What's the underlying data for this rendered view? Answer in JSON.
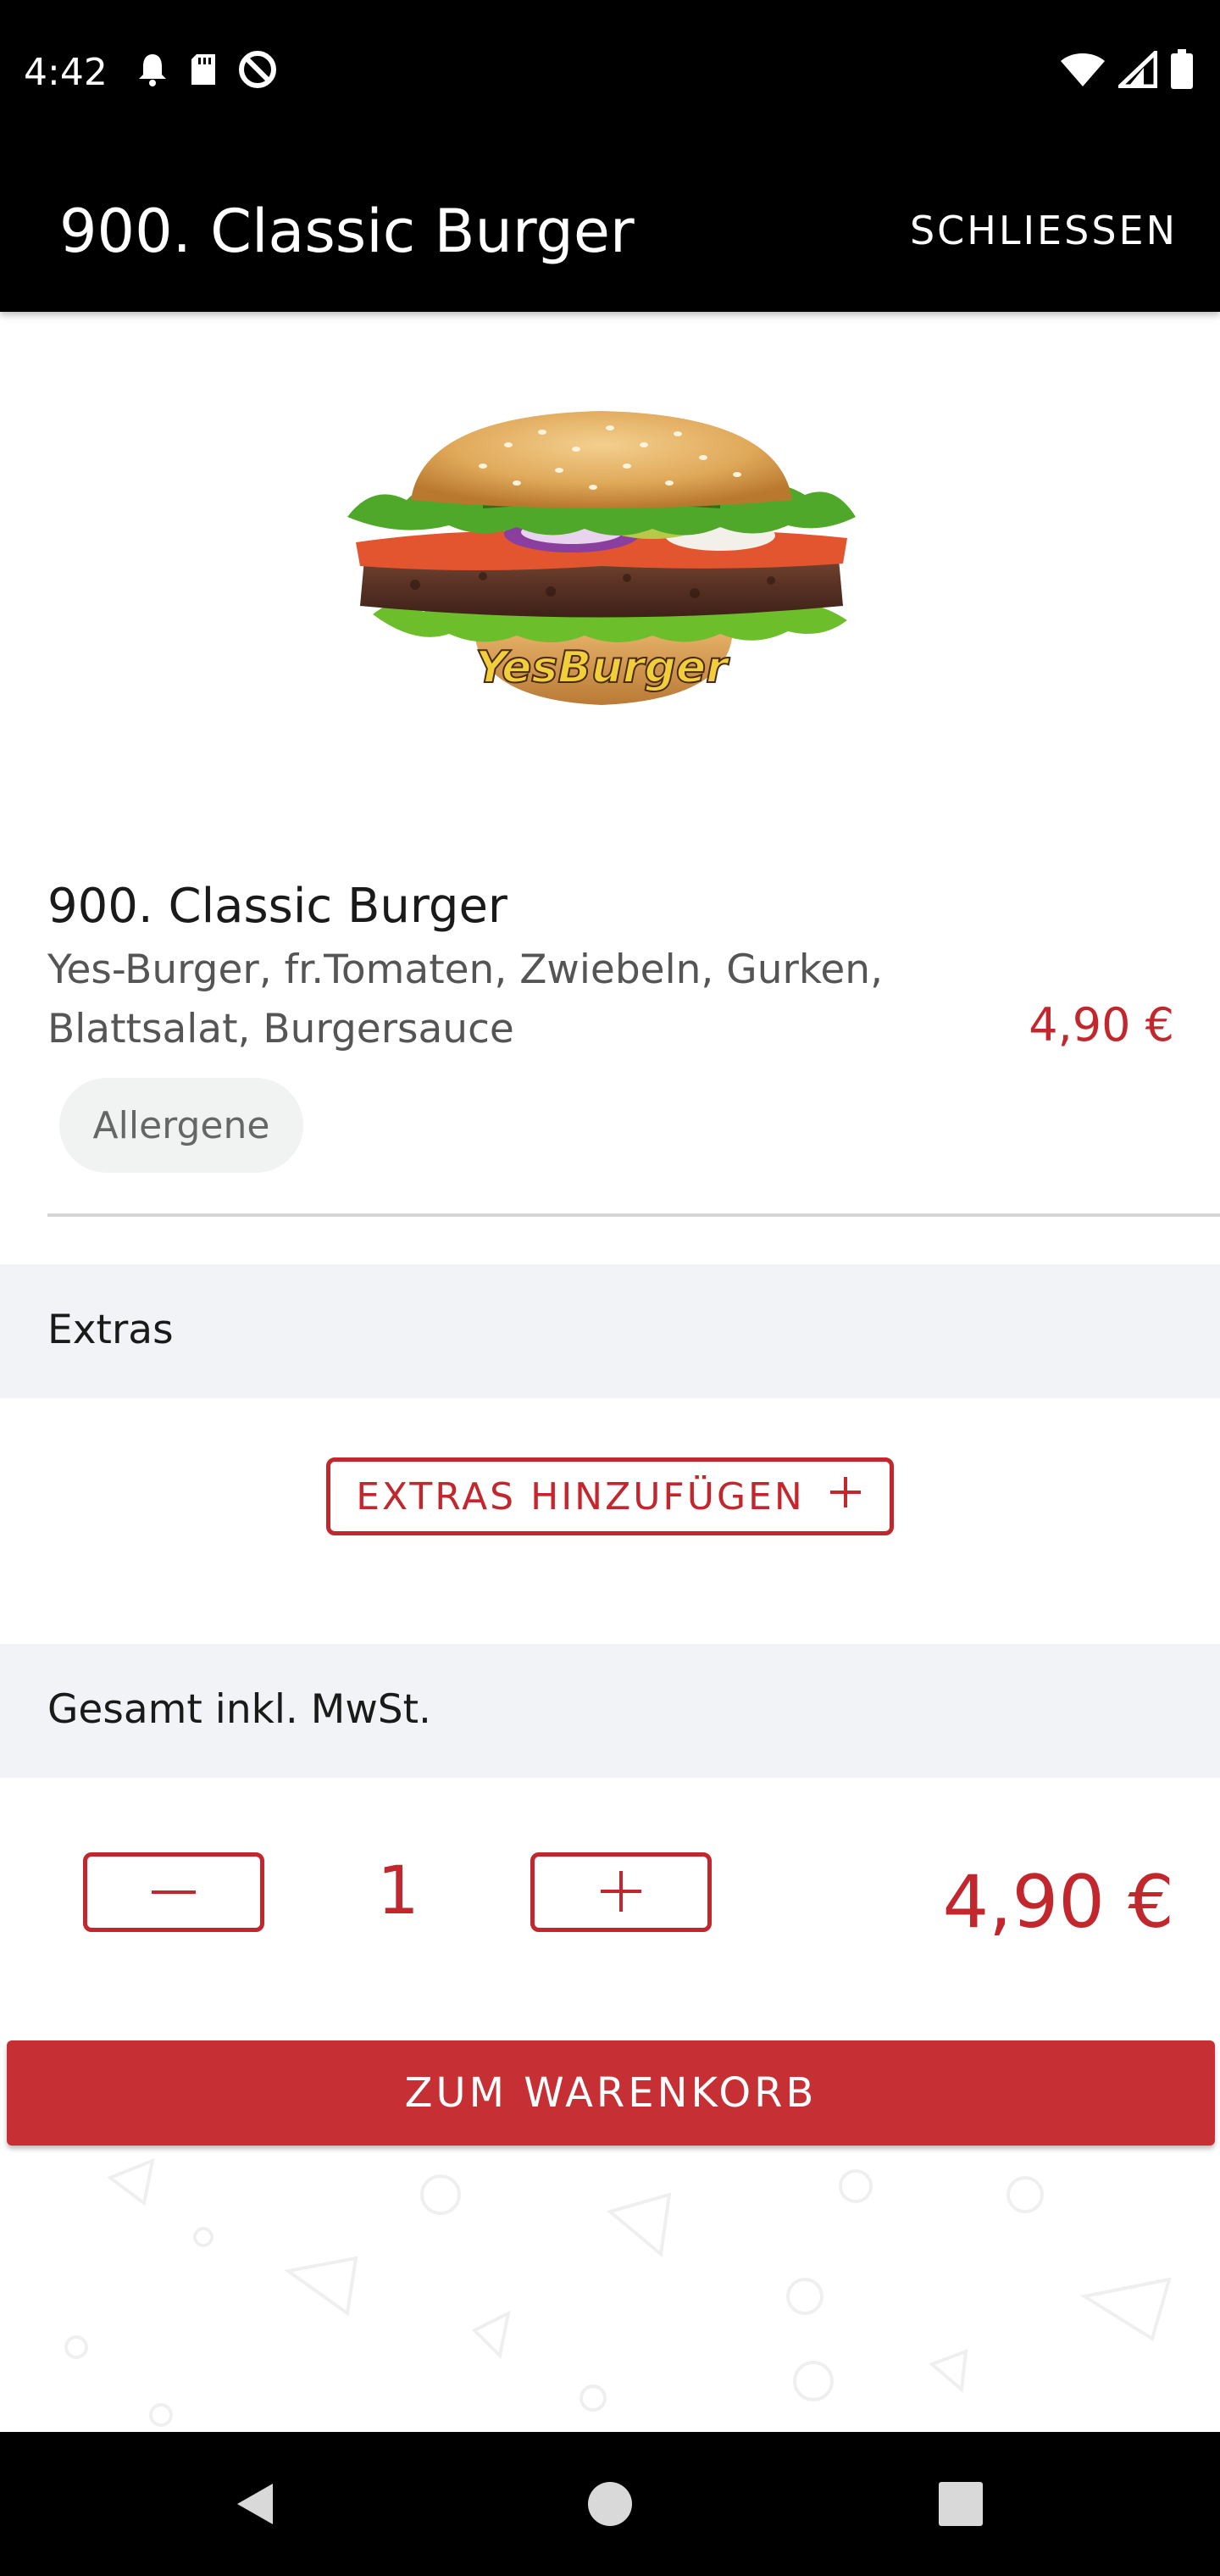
{
  "status_bar": {
    "time": "4:42",
    "left_icons": [
      "bell-icon",
      "sd-card-icon",
      "data-saver-icon"
    ],
    "right_icons": [
      "wifi-icon",
      "cell-signal-icon",
      "battery-icon"
    ]
  },
  "app_bar": {
    "title": "900. Classic Burger",
    "close_label": "SCHLIESSEN"
  },
  "product": {
    "image_brand": "YesBurger",
    "name": "900. Classic Burger",
    "description": "Yes-Burger, fr.Tomaten, Zwiebeln, Gurken, Blattsalat, Burgersauce",
    "price": "4,90 €",
    "allergen_label": "Allergene"
  },
  "extras": {
    "section_label": "Extras",
    "add_button_label": "EXTRAS HINZUFÜGEN"
  },
  "total": {
    "section_label": "Gesamt inkl. MwSt.",
    "quantity": "1",
    "price": "4,90 €"
  },
  "cart_button_label": "ZUM WARENKORB",
  "colors": {
    "accent": "#c1272d",
    "cart_button": "#c62f33",
    "section_band": "#f2f3f6",
    "bar_background": "#000000"
  },
  "nav_bar": {
    "icons": [
      "back-icon",
      "home-icon",
      "recents-icon"
    ]
  }
}
